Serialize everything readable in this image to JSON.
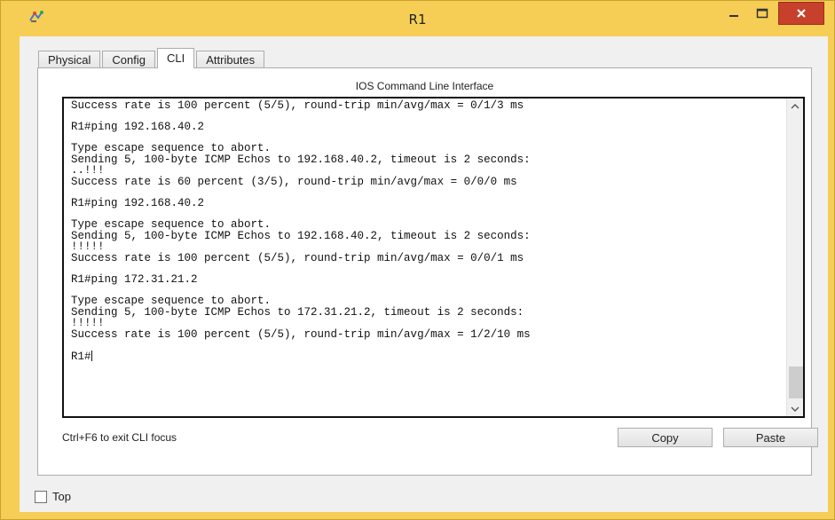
{
  "window": {
    "title": "R1",
    "minimize_glyph": "–",
    "close_glyph": "✕",
    "frame_color": "#f6ce56",
    "close_color": "#c7402b"
  },
  "tabs": [
    {
      "label": "Physical",
      "active": false
    },
    {
      "label": "Config",
      "active": false
    },
    {
      "label": "CLI",
      "active": true
    },
    {
      "label": "Attributes",
      "active": false
    }
  ],
  "cli": {
    "title": "IOS Command Line Interface",
    "lines": [
      "Success rate is 100 percent (5/5), round-trip min/avg/max = 0/1/3 ms",
      "",
      "R1#ping 192.168.40.2",
      "",
      "Type escape sequence to abort.",
      "Sending 5, 100-byte ICMP Echos to 192.168.40.2, timeout is 2 seconds:",
      "..!!!",
      "Success rate is 60 percent (3/5), round-trip min/avg/max = 0/0/0 ms",
      "",
      "R1#ping 192.168.40.2",
      "",
      "Type escape sequence to abort.",
      "Sending 5, 100-byte ICMP Echos to 192.168.40.2, timeout is 2 seconds:",
      "!!!!!",
      "Success rate is 100 percent (5/5), round-trip min/avg/max = 0/0/1 ms",
      "",
      "R1#ping 172.31.21.2",
      "",
      "Type escape sequence to abort.",
      "Sending 5, 100-byte ICMP Echos to 172.31.21.2, timeout is 2 seconds:",
      "!!!!!",
      "Success rate is 100 percent (5/5), round-trip min/avg/max = 1/2/10 ms",
      ""
    ],
    "prompt": "R1#"
  },
  "footer": {
    "hint": "Ctrl+F6 to exit CLI focus",
    "copy_label": "Copy",
    "paste_label": "Paste"
  },
  "options": {
    "top_label": "Top",
    "top_checked": false
  }
}
